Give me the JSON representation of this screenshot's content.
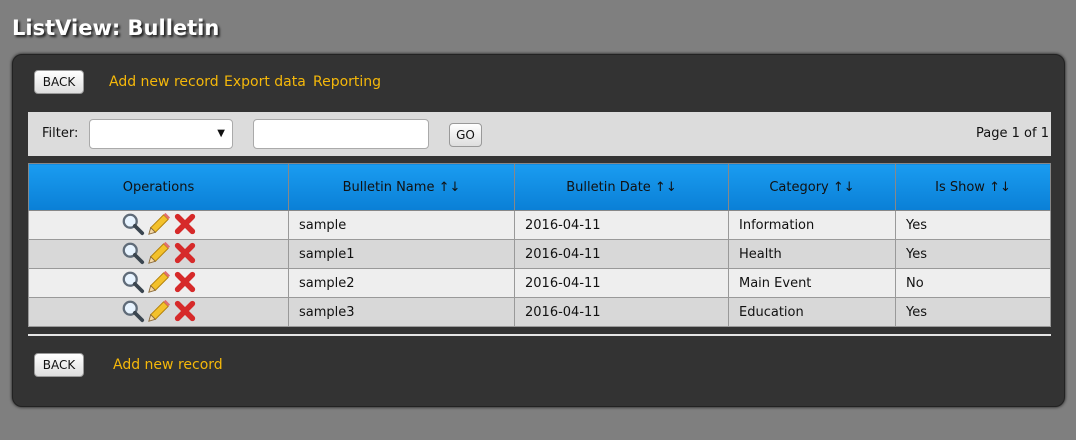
{
  "page_title": "ListView: Bulletin",
  "toolbar": {
    "back_label": "BACK",
    "add_label": "Add new record",
    "export_label": "Export data",
    "report_label": "Reporting"
  },
  "filter": {
    "label": "Filter:",
    "select_value": "",
    "input_value": "",
    "go_label": "GO",
    "page_info": "Page 1 of 1"
  },
  "table": {
    "headers": [
      "Operations",
      "Bulletin Name ↑↓",
      "Bulletin Date ↑↓",
      "Category ↑↓",
      "Is Show ↑↓"
    ],
    "rows": [
      {
        "name": "sample",
        "date": "2016-04-11",
        "category": "Information",
        "is_show": "Yes"
      },
      {
        "name": "sample1",
        "date": "2016-04-11",
        "category": "Health",
        "is_show": "Yes"
      },
      {
        "name": "sample2",
        "date": "2016-04-11",
        "category": "Main Event",
        "is_show": "No"
      },
      {
        "name": "sample3",
        "date": "2016-04-11",
        "category": "Education",
        "is_show": "Yes"
      }
    ],
    "operation_icons": [
      "magnifier-icon",
      "pencil-icon",
      "delete-x-icon"
    ]
  },
  "footer": {
    "back_label": "BACK",
    "add_label": "Add new record"
  },
  "colors": {
    "link": "#f5b80a",
    "header": "#0a8ae0",
    "panel": "#333333",
    "background": "#7f7f7f"
  }
}
